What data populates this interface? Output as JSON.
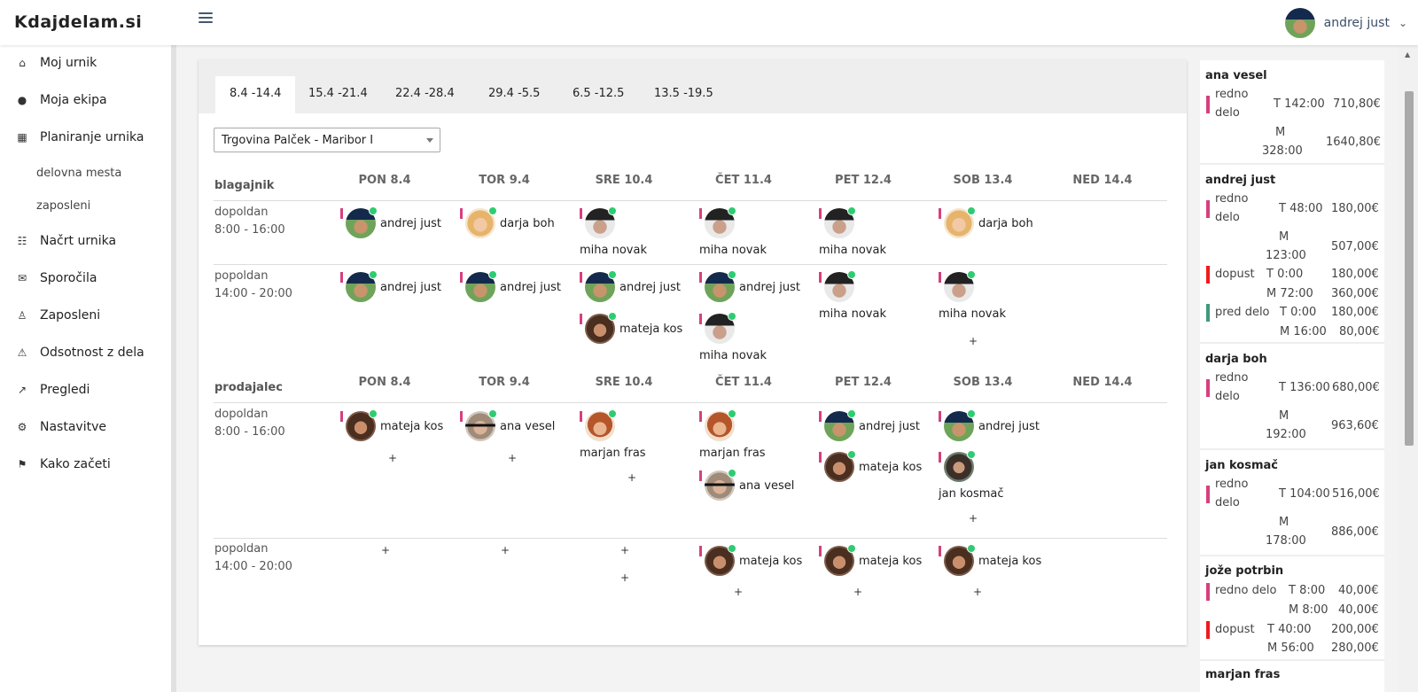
{
  "header": {
    "brand": "Kdajdelam.si",
    "user_name": "andrej just",
    "user_chevron": "⌵"
  },
  "sidebar": {
    "items": [
      {
        "label": "Moj urnik",
        "icon": "home-icon",
        "glyph": "⌂"
      },
      {
        "label": "Moja ekipa",
        "icon": "users-icon",
        "glyph": "●"
      },
      {
        "label": "Planiranje urnika",
        "icon": "calendar-icon",
        "glyph": "▦"
      },
      {
        "label": "Načrt urnika",
        "icon": "sitemap-icon",
        "glyph": "☷"
      },
      {
        "label": "Sporočila",
        "icon": "comments-icon",
        "glyph": "✉"
      },
      {
        "label": "Zaposleni",
        "icon": "user-icon",
        "glyph": "♙"
      },
      {
        "label": "Odsotnost z dela",
        "icon": "warning-icon",
        "glyph": "⚠"
      },
      {
        "label": "Pregledi",
        "icon": "chart-line-icon",
        "glyph": "↗"
      },
      {
        "label": "Nastavitve",
        "icon": "gear-icon",
        "glyph": "⚙"
      },
      {
        "label": "Kako začeti",
        "icon": "signpost-icon",
        "glyph": "⚑"
      }
    ],
    "subitems": [
      {
        "label": "delovna mesta"
      },
      {
        "label": "zaposleni"
      }
    ]
  },
  "tabs": [
    "8.4 -14.4",
    "15.4 -21.4",
    "22.4 -28.4",
    "29.4 -5.5",
    "6.5 -12.5",
    "13.5 -19.5"
  ],
  "store_select": {
    "value": "Trgovina Palček - Maribor I"
  },
  "days": [
    "PON 8.4",
    "TOR 9.4",
    "SRE 10.4",
    "ČET 11.4",
    "PET 12.4",
    "SOB 13.4",
    "NED 14.4"
  ],
  "plus": "+",
  "sections": [
    {
      "name": "blagajnik",
      "shifts": [
        {
          "name": "dopoldan",
          "time": "8:00 - 16:00"
        },
        {
          "name": "popoldan",
          "time": "14:00 - 20:00"
        }
      ]
    },
    {
      "name": "prodajalec",
      "shifts": [
        {
          "name": "dopoldan",
          "time": "8:00 - 16:00"
        },
        {
          "name": "popoldan",
          "time": "14:00 - 20:00"
        }
      ]
    }
  ],
  "people": {
    "andrej": "andrej just",
    "darja": "darja boh",
    "miha": "miha novak",
    "mateja": "mateja kos",
    "ana": "ana vesel",
    "marjan": "marjan fras",
    "jan": "jan kosmač"
  },
  "summary": [
    {
      "name": "ana vesel",
      "lines": [
        {
          "type": "redno",
          "type_l1": "redno",
          "type_l2": "delo",
          "t": "T 142:00",
          "t_money": "710,80€",
          "m_l1": "M",
          "m_l2": "328:00",
          "m_money": "1640,80€"
        }
      ]
    },
    {
      "name": "andrej just",
      "lines": [
        {
          "type": "redno",
          "type_l1": "redno",
          "type_l2": "delo",
          "t": "T 48:00",
          "t_money": "180,00€",
          "m_l1": "M",
          "m_l2": "123:00",
          "m_money": "507,00€"
        },
        {
          "type": "dopust",
          "label": "dopust",
          "t": "T 0:00",
          "t_money": "180,00€",
          "m": "M 72:00",
          "m_money": "360,00€"
        },
        {
          "type": "pred",
          "label": "pred delo",
          "t": "T 0:00",
          "t_money": "180,00€",
          "m": "M 16:00",
          "m_money": "80,00€"
        }
      ]
    },
    {
      "name": "darja boh",
      "lines": [
        {
          "type": "redno",
          "type_l1": "redno",
          "type_l2": "delo",
          "t": "T 136:00",
          "t_money": "680,00€",
          "m_l1": "M",
          "m_l2": "192:00",
          "m_money": "963,60€"
        }
      ]
    },
    {
      "name": "jan kosmač",
      "lines": [
        {
          "type": "redno",
          "type_l1": "redno",
          "type_l2": "delo",
          "t": "T 104:00",
          "t_money": "516,00€",
          "m_l1": "M",
          "m_l2": "178:00",
          "m_money": "886,00€"
        }
      ]
    },
    {
      "name": "jože potrbin",
      "lines": [
        {
          "type": "redno",
          "label": "redno delo",
          "t": "T 8:00",
          "t_money": "40,00€",
          "m": "M 8:00",
          "m_money": "40,00€"
        },
        {
          "type": "dopust",
          "label": "dopust",
          "t": "T 40:00",
          "t_money": "200,00€",
          "m": "M 56:00",
          "m_money": "280,00€"
        }
      ]
    },
    {
      "name": "marjan fras",
      "lines": []
    }
  ],
  "colors": {
    "redno": "#d6407e",
    "dopust": "#ee1b1b",
    "pred_delo": "#3f9a79",
    "online_dot": "#2ecc71"
  }
}
